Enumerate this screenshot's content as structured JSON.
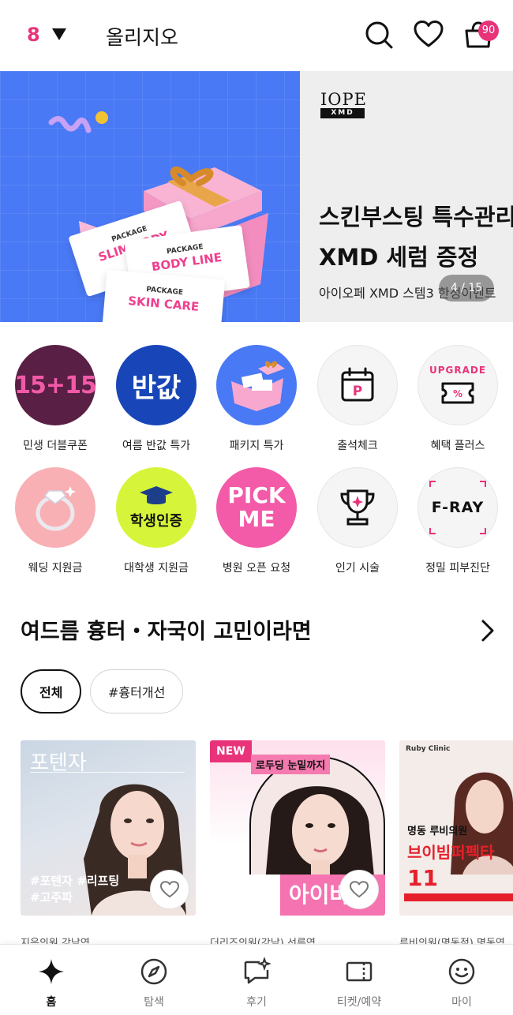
{
  "header": {
    "location_count": "8",
    "title": "올리지오",
    "cart_badge": "90",
    "icons": [
      "search-icon",
      "heart-icon",
      "cart-icon"
    ]
  },
  "banner": {
    "brand_top": "IOPE",
    "brand_sub": "XMD",
    "title_line1": "스킨부스팅 특수관리",
    "title_line2": "XMD 세럼 증정",
    "subtitle": "아이오페 XMD 스템3 한정이벤트",
    "page_indicator": "4 / 15",
    "ticket_labels": [
      {
        "tag": "PACKAGE",
        "name": "SLIM BODY"
      },
      {
        "tag": "PACKAGE",
        "name": "BODY LINE"
      },
      {
        "tag": "PACKAGE",
        "name": "SKIN CARE"
      }
    ]
  },
  "categories": [
    {
      "label": "민생 더블쿠폰",
      "icon_text": "15+15"
    },
    {
      "label": "여름 반값 특가",
      "icon_text": "반값"
    },
    {
      "label": "패키지 특가",
      "icon_text": ""
    },
    {
      "label": "출석체크",
      "icon_text": "P"
    },
    {
      "label": "혜택 플러스",
      "icon_text": "UPGRADE"
    },
    {
      "label": "웨딩 지원금",
      "icon_text": ""
    },
    {
      "label": "대학생 지원금",
      "icon_text": "학생인증"
    },
    {
      "label": "병원 오픈 요청",
      "icon_text": "PICK ME"
    },
    {
      "label": "인기 시술",
      "icon_text": ""
    },
    {
      "label": "정밀 피부진단",
      "icon_text": "F-RAY"
    }
  ],
  "section": {
    "title": "여드름 흉터・자국이 고민이라면",
    "chips": [
      "전체",
      "#흉터개선"
    ]
  },
  "cards": [
    {
      "overlay_title": "포텐자",
      "tags": "#포텐자 #리프팅\n#고주파",
      "caption": "지음의원 강남역"
    },
    {
      "badge": "NEW",
      "banner_text": "로두딩 눈밑까지",
      "overlay_word": "아이바",
      "caption": "더리즈의원(강남) 선릉역"
    },
    {
      "clinic": "Ruby Clinic",
      "headline": "명동 루비의원",
      "promo": "브이빔퍼펙타",
      "caption": "루비의원(명동점) 명동역"
    }
  ],
  "bottom_nav": [
    {
      "label": "홈",
      "icon": "home-sparkle-icon"
    },
    {
      "label": "탐색",
      "icon": "compass-icon"
    },
    {
      "label": "후기",
      "icon": "review-icon"
    },
    {
      "label": "티켓/예약",
      "icon": "ticket-icon"
    },
    {
      "label": "마이",
      "icon": "smile-icon"
    }
  ],
  "colors": {
    "accent": "#e8337a",
    "banner_blue": "#4a79f5"
  }
}
